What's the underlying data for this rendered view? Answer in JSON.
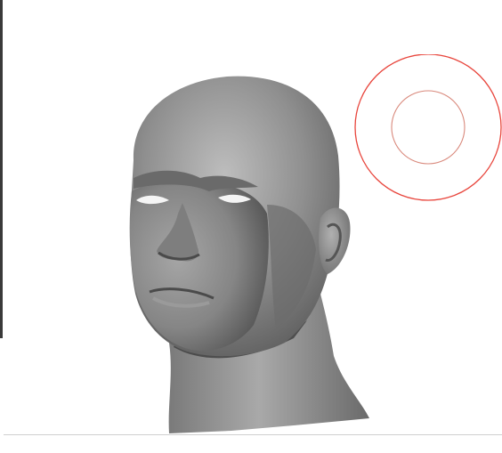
{
  "viewport": {
    "background": "#ffffff"
  },
  "model": {
    "icon": "sculpted-head-model",
    "material_color": "#8e8e8e"
  },
  "brush_cursor": {
    "icon": "brush-radius-cursor",
    "outer_color": "#e8453c",
    "inner_color": "#d9897c"
  }
}
